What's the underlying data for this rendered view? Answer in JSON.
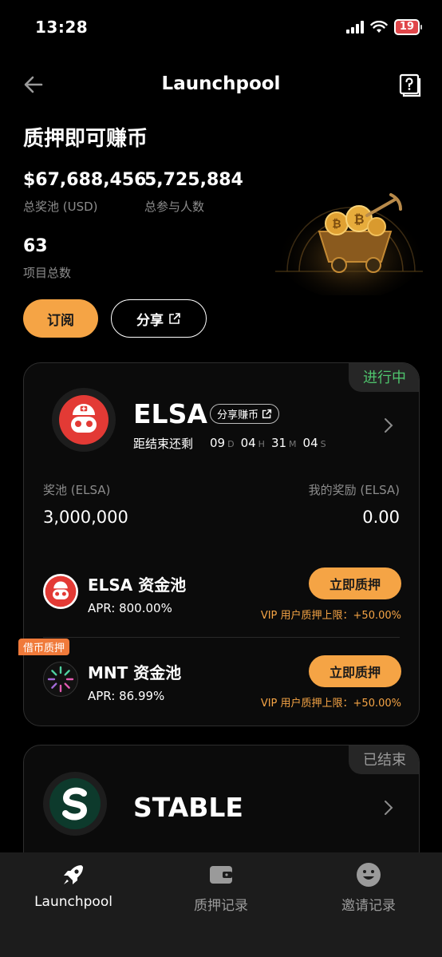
{
  "status": {
    "time": "13:28",
    "battery": "19"
  },
  "nav": {
    "title": "Launchpool"
  },
  "hero": {
    "title": "质押即可赚币",
    "total_pool_value": "$67,688,456",
    "total_pool_label": "总奖池 (USD)",
    "participants_value": "5,725,884",
    "participants_label": "总参与人数",
    "projects_value": "63",
    "projects_label": "项目总数",
    "subscribe_label": "订阅",
    "share_label": "分享"
  },
  "projects": [
    {
      "status": "进行中",
      "name": "ELSA",
      "share_earn_label": "分享赚币",
      "countdown_label": "距结束还剩",
      "countdown": {
        "d": "09",
        "d_unit": "D",
        "h": "04",
        "h_unit": "H",
        "m": "31",
        "m_unit": "M",
        "s": "04",
        "s_unit": "S"
      },
      "pool_label": "奖池 (ELSA)",
      "pool_value": "3,000,000",
      "reward_label": "我的奖励 (ELSA)",
      "reward_value": "0.00",
      "pools": [
        {
          "name": "ELSA 资金池",
          "apr": "APR: 800.00%",
          "button": "立即质押",
          "vip": "VIP 用户质押上限：+50.00%"
        },
        {
          "tag": "借币质押",
          "name": "MNT 资金池",
          "apr": "APR: 86.99%",
          "button": "立即质押",
          "vip": "VIP 用户质押上限：+50.00%"
        }
      ]
    },
    {
      "status": "已结束",
      "name": "STABLE"
    }
  ],
  "tabs": [
    {
      "label": "Launchpool",
      "icon": "rocket-icon"
    },
    {
      "label": "质押记录",
      "icon": "wallet-icon"
    },
    {
      "label": "邀请记录",
      "icon": "smiley-icon"
    }
  ],
  "colors": {
    "accent": "#f5a445",
    "active_status": "#4fc46d",
    "tag": "#f07a3a"
  }
}
